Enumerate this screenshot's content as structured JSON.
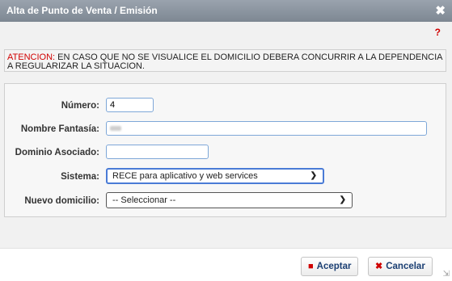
{
  "window": {
    "title": "Alta de Punto de Venta / Emisión",
    "close_glyph": "✖"
  },
  "help_glyph": "?",
  "warning": {
    "label": "ATENCION:",
    "text": " EN CASO QUE NO SE VISUALICE EL DOMICILIO DEBERA CONCURRIR A LA DEPENDENCIA A REGULARIZAR LA SITUACION."
  },
  "form": {
    "numero": {
      "label": "Número:",
      "value": "4"
    },
    "nombre_fantasia": {
      "label": "Nombre Fantasía:",
      "value": ""
    },
    "dominio_asociado": {
      "label": "Dominio Asociado:",
      "value": ""
    },
    "sistema": {
      "label": "Sistema:",
      "selected": "RECE para aplicativo y web services"
    },
    "nuevo_domicilio": {
      "label": "Nuevo domicilio:",
      "selected": "-- Seleccionar --"
    }
  },
  "buttons": {
    "aceptar": "Aceptar",
    "cancelar": "Cancelar"
  },
  "colors": {
    "accent": "#1b3f73",
    "warning": "#d00000",
    "titlebar": "#8a939e"
  },
  "icons": {
    "aceptar_icon": "save-icon",
    "cancelar_icon": "x-icon"
  }
}
